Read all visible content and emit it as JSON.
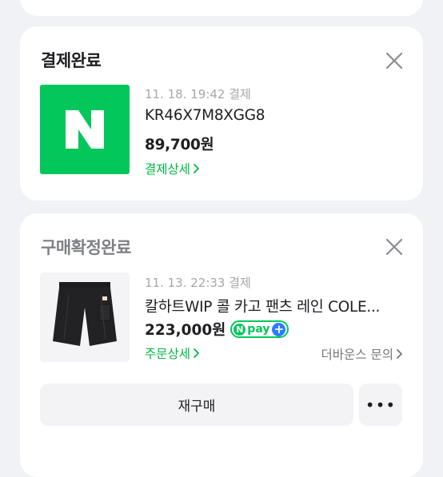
{
  "payment_card": {
    "title": "결제완료",
    "meta": "11. 18. 19:42 결제",
    "order_id": "KR46X7M8XGG8",
    "amount": "89,700원",
    "detail_link": "결제상세",
    "logo_letter": "N",
    "brand_color": "#03c75a"
  },
  "order_card": {
    "title": "구매확정완료",
    "meta": "11. 13. 22:33 결제",
    "product_name": "칼하트WIP 콜 카고 팬츠 레인 COLE...",
    "price": "223,000원",
    "npay_badge": {
      "n": "N",
      "text": "pay",
      "plus": "+"
    },
    "detail_link": "주문상세",
    "seller_link": "더바운스 문의",
    "rebuy_button": "재구매",
    "more_button": "•••"
  },
  "colors": {
    "link_green": "#00b843",
    "npay_blue": "#2b7cff",
    "background": "#f1f2f6"
  }
}
